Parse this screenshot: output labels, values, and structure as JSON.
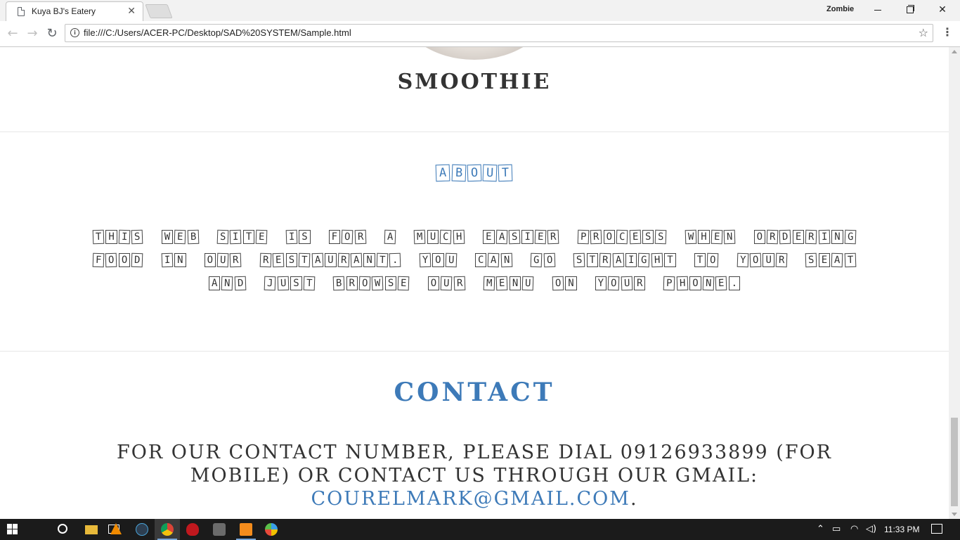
{
  "browser": {
    "tab_title": "Kuya BJ's Eatery",
    "profile_name": "Zombie",
    "url": "file:///C:/Users/ACER-PC/Desktop/SAD%20SYSTEM/Sample.html"
  },
  "page": {
    "menu_item_title": "SMOOTHIE",
    "about": {
      "title_letters": [
        "A",
        "B",
        "O",
        "U",
        "T"
      ],
      "text_words": [
        "THIS",
        "WEB",
        "SITE",
        "IS",
        "FOR",
        "A",
        "MUCH",
        "EASIER",
        "PROCESS",
        "WHEN",
        "ORDERING",
        "FOOD",
        "IN",
        "OUR",
        "RESTAURANT.",
        "YOU",
        "CAN",
        "GO",
        "STRAIGHT",
        "TO",
        "YOUR",
        "SEAT",
        "AND",
        "JUST",
        "BROWSE",
        "OUR",
        "MENU",
        "ON",
        "YOUR",
        "PHONE."
      ]
    },
    "contact": {
      "title": "CONTACT",
      "text_before": "FOR OUR CONTACT NUMBER, PLEASE DIAL 09126933899 (FOR MOBILE) OR CONTACT US THROUGH OUR GMAIL:",
      "email": "COURELMARK@GMAIL.COM",
      "text_after": "."
    }
  },
  "taskbar": {
    "time": "11:33 PM"
  },
  "colors": {
    "accent_blue": "#3d7ab8",
    "text_dark": "#333333",
    "taskbar_bg": "#1b1b1b"
  }
}
